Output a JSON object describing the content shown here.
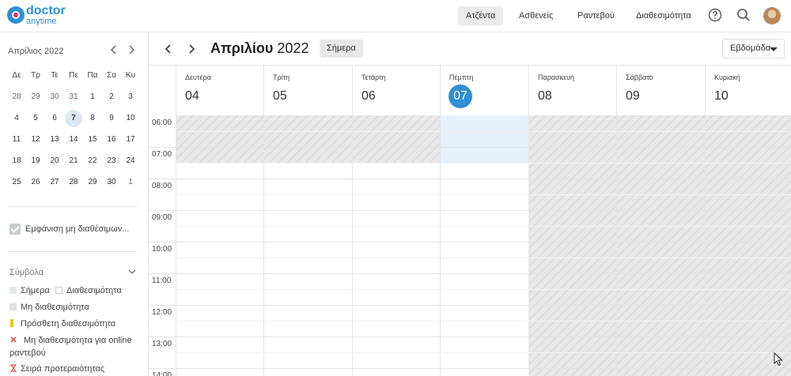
{
  "app": {
    "logo_primary": "doctor",
    "logo_secondary": "anytime"
  },
  "nav": {
    "items": [
      "Ατζέντα",
      "Ασθενείς",
      "Ραντεβού",
      "Διαθεσιμότητα"
    ],
    "active": "Ατζέντα"
  },
  "mini_calendar": {
    "title": "Απρίλιος 2022",
    "weekdays": [
      "Δε",
      "Τρ",
      "Τε",
      "Πε",
      "Πα",
      "Σα",
      "Κυ"
    ],
    "weeks": [
      [
        "28",
        "29",
        "30",
        "31",
        "1",
        "2",
        "3"
      ],
      [
        "4",
        "5",
        "6",
        "7",
        "8",
        "9",
        "10"
      ],
      [
        "11",
        "12",
        "13",
        "14",
        "15",
        "16",
        "17"
      ],
      [
        "18",
        "19",
        "20",
        "21",
        "22",
        "23",
        "24"
      ],
      [
        "25",
        "26",
        "27",
        "28",
        "29",
        "30",
        "1"
      ]
    ],
    "today": "7"
  },
  "sidebar": {
    "show_unavailable_label": "Εμφάνιση μη διαθέσιμων...",
    "legend_title": "Σύμβολα",
    "legend": {
      "today": "Σήμερα",
      "availability": "Διαθεσιμότητα",
      "unavailability": "Μη διαθεσιμότητα",
      "extra_availability": "Πρόσθετη διαθεσιμότητα",
      "no_online_line1": "Μη διαθεσιμότητα για online",
      "no_online_line2": "ραντεβού",
      "priority": "Σειρά προτεραιότητας"
    }
  },
  "calendar": {
    "month_bold": "Απριλίου",
    "year": "2022",
    "today_button": "Σήμερα",
    "view": "Εβδομάδα",
    "days": [
      {
        "name": "Δευτέρα",
        "num": "04"
      },
      {
        "name": "Τρίτη",
        "num": "05"
      },
      {
        "name": "Τετάρτη",
        "num": "06"
      },
      {
        "name": "Πέμπτη",
        "num": "07",
        "today": true
      },
      {
        "name": "Παρασκευή",
        "num": "08"
      },
      {
        "name": "Σάββατο",
        "num": "09"
      },
      {
        "name": "Κυριακή",
        "num": "10"
      }
    ],
    "times": [
      "06:00",
      "07:00",
      "08:00",
      "09:00",
      "10:00",
      "11:00",
      "12:00",
      "13:00",
      "14:00"
    ]
  },
  "colors": {
    "brand": "#2f8fd4",
    "today_highlight": "#e6f1fb",
    "extra_availability": "#f0c419",
    "no_online": "#e05050"
  }
}
